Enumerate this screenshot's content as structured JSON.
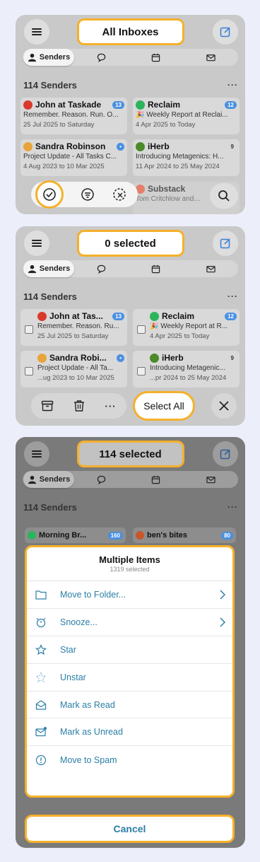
{
  "panel1": {
    "title": "All Inboxes",
    "tab_senders": "Senders",
    "sender_count": "114 Senders",
    "more": "···",
    "cards": [
      {
        "name": "John at Taskade",
        "badge": "13",
        "subject": "Remember. Reason. Run. O...",
        "date": "25 Jul 2025 to Saturday",
        "avatar_color": "#d93a2b"
      },
      {
        "name": "Reclaim",
        "badge": "12",
        "subject": "🎉 Weekly Report at Reclai...",
        "date": "4 Apr 2025 to Today",
        "avatar_color": "#2bb55a"
      },
      {
        "name": "Sandra Robinson",
        "badge": "•",
        "subject": "Project Update - All Tasks C...",
        "date": "4 Aug 2023 to 10 Mar 2025",
        "avatar_color": "#e8a43a"
      },
      {
        "name": "iHerb",
        "badge": "9",
        "subject": "Introducing Metagenics: H...",
        "date": "11 Apr 2024 to 25 May 2024",
        "avatar_color": "#4b8b2a"
      }
    ],
    "peek_left": "…tka…",
    "peek_right": "Substack",
    "peek_right_sub": "Tom Critchlow and…"
  },
  "panel2": {
    "title": "0 selected",
    "tab_senders": "Senders",
    "sender_count": "114 Senders",
    "more": "···",
    "cards": [
      {
        "name": "John at Tas...",
        "badge": "13",
        "subject": "Remember. Reason. Ru...",
        "date": "25 Jul 2025 to Saturday",
        "avatar_color": "#d93a2b"
      },
      {
        "name": "Reclaim",
        "badge": "12",
        "subject": "🎉 Weekly Report at R...",
        "date": "4 Apr 2025 to Today",
        "avatar_color": "#2bb55a"
      },
      {
        "name": "Sandra Robi...",
        "badge": "•",
        "subject": "Project Update - All Ta...",
        "date": "...ug 2023 to 10 Mar 2025",
        "avatar_color": "#e8a43a"
      },
      {
        "name": "iHerb",
        "badge": "9",
        "subject": "Introducing Metagenic...",
        "date": "...pr 2024 to 25 May 2024",
        "avatar_color": "#4b8b2a"
      }
    ],
    "select_all": "Select All",
    "bar_more": "···"
  },
  "panel3": {
    "title": "114 selected",
    "tab_senders": "Senders",
    "sender_count": "114 Senders",
    "more": "···",
    "peek_left": "Morning Br...",
    "peek_left_badge": "160",
    "peek_right": "ben's bites",
    "peek_right_badge": "80",
    "sheet_title": "Multiple Items",
    "sheet_sub": "1319 selected",
    "menu": [
      {
        "label": "Move to Folder...",
        "icon": "folder-icon",
        "chevron": true
      },
      {
        "label": "Snooze...",
        "icon": "snooze-icon",
        "chevron": true
      },
      {
        "label": "Star",
        "icon": "star-icon",
        "chevron": false
      },
      {
        "label": "Unstar",
        "icon": "unstar-icon",
        "chevron": false
      },
      {
        "label": "Mark as Read",
        "icon": "mark-read-icon",
        "chevron": false
      },
      {
        "label": "Mark as Unread",
        "icon": "mark-unread-icon",
        "chevron": false
      },
      {
        "label": "Move to Spam",
        "icon": "spam-icon",
        "chevron": false
      }
    ],
    "cancel": "Cancel"
  },
  "colors": {
    "highlight": "#f5b02b",
    "link": "#2b7fa6",
    "badge": "#4a90e2"
  }
}
